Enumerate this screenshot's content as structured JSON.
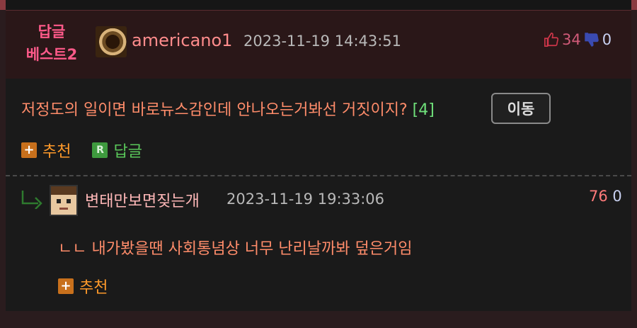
{
  "best_comment": {
    "badge_line1": "답글",
    "badge_line2": "베스트2",
    "username": "americano1",
    "datetime": "2023-11-19 14:43:51",
    "upvotes": "34",
    "downvotes": "0",
    "text": "저정도의 일이면 바로뉴스감인데 안나오는거봐선 거짓이지?",
    "reply_count": "[4]",
    "move_button": "이동",
    "recommend_label": "추천",
    "reply_label": "답글",
    "reply_icon_letter": "R"
  },
  "reply": {
    "username": "변태만보면짖는개",
    "datetime": "2023-11-19 19:33:06",
    "upvotes": "76",
    "downvotes": "0",
    "text": "ㄴㄴ 내가봤을땐 사회통념상 너무 난리날까봐 덮은거임",
    "recommend_label": "추천"
  },
  "icons": {
    "plus": "+",
    "thumb_up": "thumb-up-icon",
    "thumb_down": "thumb-down-icon",
    "reply_arrow": "reply-arrow-icon"
  },
  "colors": {
    "background": "#1a1a1a",
    "best_header": "#2a1718",
    "frame": "#b8484f",
    "badge": "#ff5a8a",
    "username": "#ff8c8c",
    "comment_text": "#ff8c6a",
    "reply_count": "#6fe07a",
    "action_orange": "#ff9a2a",
    "action_green": "#5ac85a"
  }
}
